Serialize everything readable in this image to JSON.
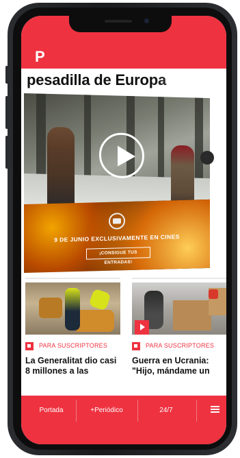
{
  "header": {
    "logo": "P",
    "brand_color": "#ee3240"
  },
  "article": {
    "headline": "pesadilla de Europa"
  },
  "video": {
    "play_icon": "play-icon"
  },
  "ad": {
    "date_text": "9 DE JUNIO EXCLUSIVAMENTE EN CINES",
    "cta_text": "¡CONSIGUE TUS ENTRADAS!"
  },
  "cards": [
    {
      "tag": "PARA SUSCRIPTORES",
      "title": "La Generalitat dio casi 8 millones a las"
    },
    {
      "tag": "PARA SUSCRIPTORES",
      "title": "Guerra en Ucrania: \"Hijo, mándame un"
    }
  ],
  "bottom_nav": {
    "items": [
      "Portada",
      "+Periódico",
      "24/7"
    ],
    "menu_icon": "hamburger-menu-icon"
  }
}
